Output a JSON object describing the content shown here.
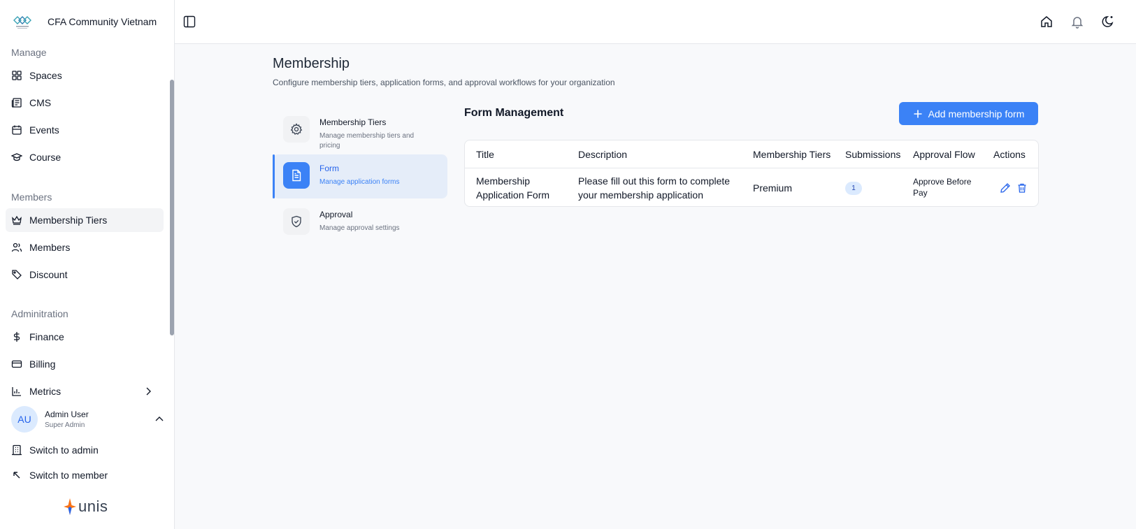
{
  "sidebar": {
    "brand": "CFA Community Vietnam",
    "sections": {
      "manage": "Manage",
      "members": "Members",
      "admin": "Adminitration"
    },
    "items": {
      "spaces": "Spaces",
      "cms": "CMS",
      "events": "Events",
      "course": "Course",
      "membership_tiers": "Membership Tiers",
      "members": "Members",
      "discount": "Discount",
      "finance": "Finance",
      "billing": "Billing",
      "metrics": "Metrics"
    },
    "user": {
      "initials": "AU",
      "name": "Admin User",
      "role": "Super Admin"
    },
    "switch_admin": "Switch to admin",
    "switch_member": "Switch to member",
    "footer_logo_text": "unis"
  },
  "page": {
    "title": "Membership",
    "subtitle": "Configure membership tiers, application forms, and approval workflows for your organization"
  },
  "subnav": [
    {
      "title": "Membership Tiers",
      "desc": "Manage membership tiers and pricing"
    },
    {
      "title": "Form",
      "desc": "Manage application forms"
    },
    {
      "title": "Approval",
      "desc": "Manage approval settings"
    }
  ],
  "form_management": {
    "heading": "Form Management",
    "add_button": "Add membership form",
    "columns": [
      "Title",
      "Description",
      "Membership Tiers",
      "Submissions",
      "Approval Flow",
      "Actions"
    ],
    "rows": [
      {
        "title": "Membership Application Form",
        "description": "Please fill out this form to complete your membership application",
        "tier": "Premium",
        "submissions": "1",
        "approval_flow": "Approve Before Pay"
      }
    ]
  },
  "colors": {
    "accent": "#3b82f6",
    "active_bg": "#e5edf9"
  }
}
